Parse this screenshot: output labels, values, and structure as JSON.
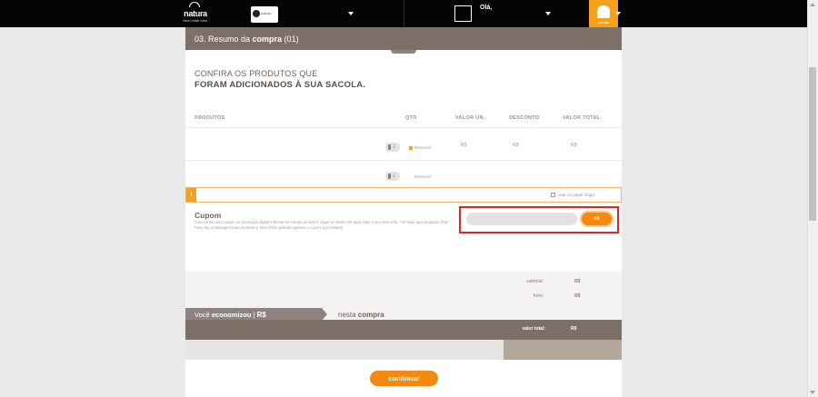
{
  "topbar": {
    "logo_text": "natura",
    "logo_subtext": "bem estar bem",
    "brand_label": "natura",
    "greeting": "Olá,",
    "bag_label": "sacola"
  },
  "summary": {
    "title_prefix": "03. Resumo da ",
    "title_bold": "compra",
    "title_suffix": " (01)",
    "confirm_line1": "CONFIRA OS PRODUTOS QUE",
    "confirm_line2": "FORAM ADICIONADOS À SUA SACOLA."
  },
  "table": {
    "headers": [
      "PRODUTOS",
      "QTD",
      "VALOR UN.",
      "DESCONTO",
      "VALOR TOTAL"
    ],
    "rows": [
      {
        "qty": "1",
        "remove_label": "Remover",
        "unit_value": "R$",
        "discount": "R$",
        "total": "R$"
      },
      {
        "qty": "1",
        "remove_label": "Remover"
      }
    ]
  },
  "notice": {
    "bang": "!",
    "checkbox_label": "usar no papel ritagio"
  },
  "coupon": {
    "title": "Cupom",
    "description": "Caso tenha uma cupom ou promoção digital informar no campo ao lado e clique no botão OK para obter o seu desconto. * Emitido para produtos Cher Para Vai, embalagem para presente e frete (frete aplicado apenas 1 cupom por compra)",
    "input_placeholder": "",
    "ok_label": "ok"
  },
  "totals": {
    "subtotal_label": "subtotal:",
    "subtotal_value": "R$",
    "frete_label": "frete:",
    "frete_value": "R$",
    "total_label": "valor total:",
    "total_value": "R$"
  },
  "savings": {
    "prefix": "Você ",
    "bold": "economizou",
    "currency": "R$",
    "suffix_plain": "nesta ",
    "suffix_bold": "compra"
  },
  "actions": {
    "continue_label": "continuar"
  },
  "colors": {
    "header_brown": "#7d7069",
    "accent_orange": "#f28a11",
    "highlight_red": "#d62a2a",
    "topbar_black": "#050505"
  }
}
